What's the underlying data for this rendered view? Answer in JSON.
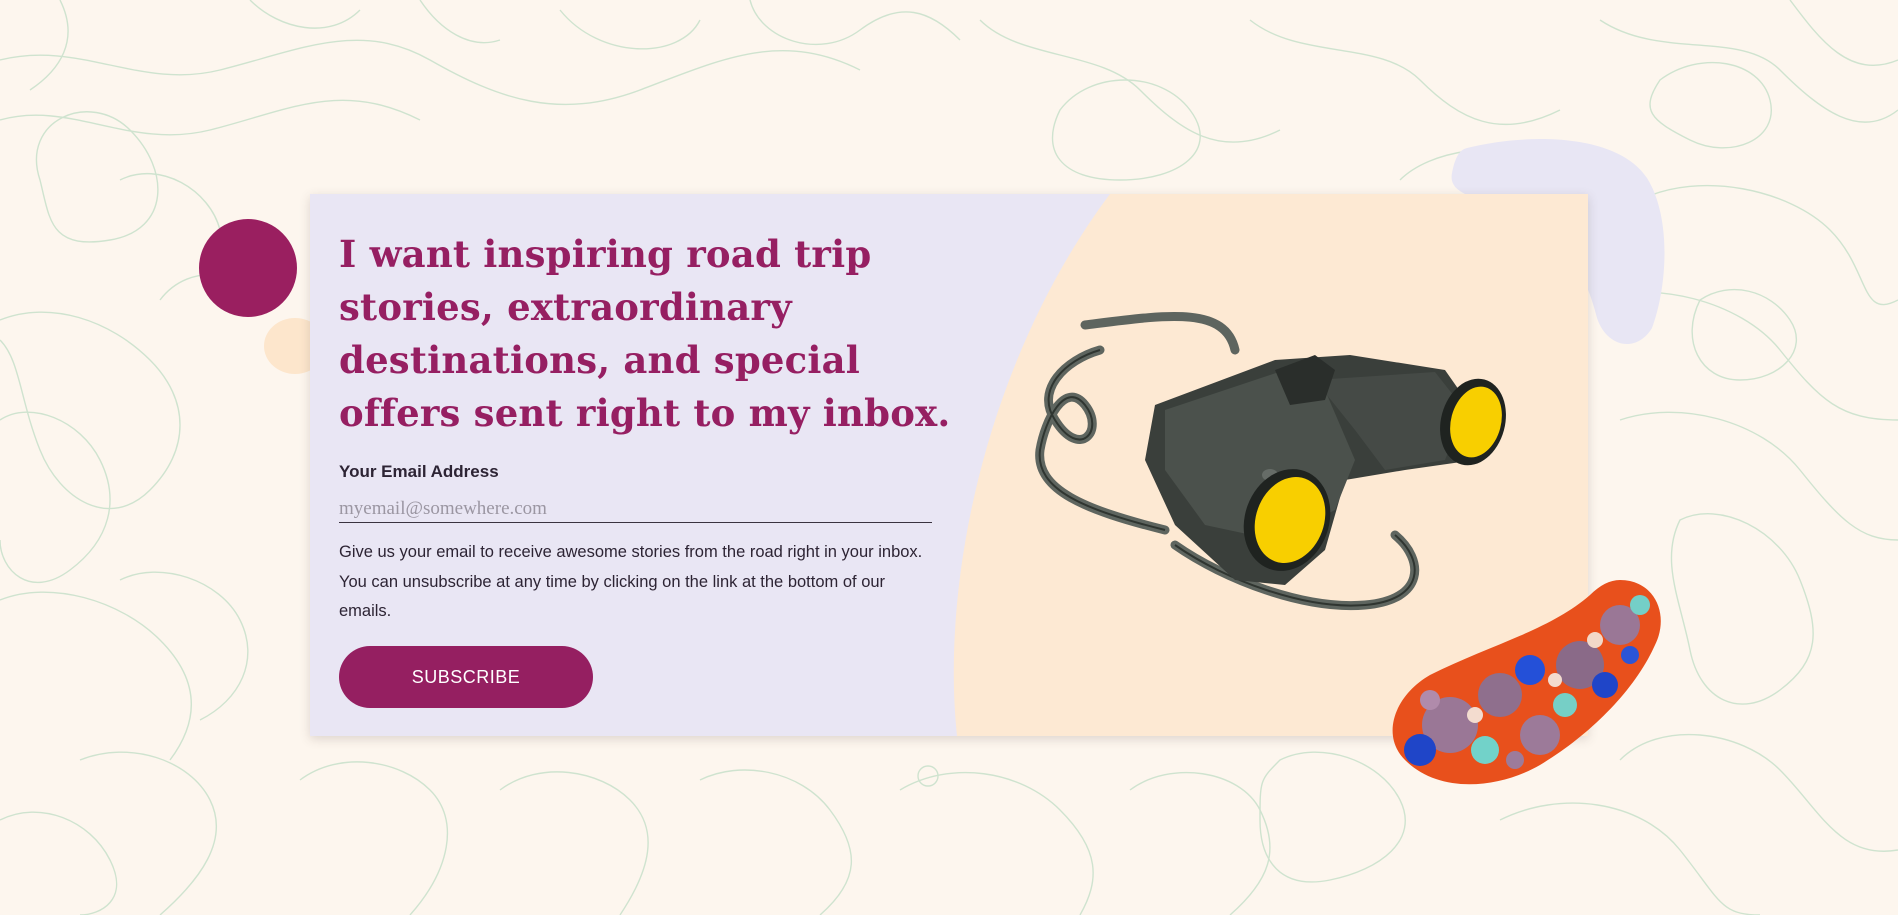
{
  "signup": {
    "headline": "I want inspiring road trip stories, extraordinary destinations, and special offers sent right to my inbox.",
    "email_label": "Your Email Address",
    "email_placeholder": "myemail@somewhere.com",
    "email_value": "",
    "helper_text": "Give us your email to receive awesome stories from the road right in your inbox. You can unsubscribe at any time by clicking on the link at the bottom of our emails.",
    "subscribe_label": "SUBSCRIBE"
  },
  "decor": {
    "illustration": "binoculars-illustration",
    "pattern": "topographic-map-lines",
    "accent_blob": "marbled-paper-blob"
  },
  "colors": {
    "page_background": "#fdf6ee",
    "card_background": "#e9e6f4",
    "illustration_background": "#fde9d3",
    "brand_purple": "#961f62",
    "text_dark": "#2d2434",
    "topo_line": "#cfe3cf",
    "binocular_lens": "#f8cf00"
  }
}
